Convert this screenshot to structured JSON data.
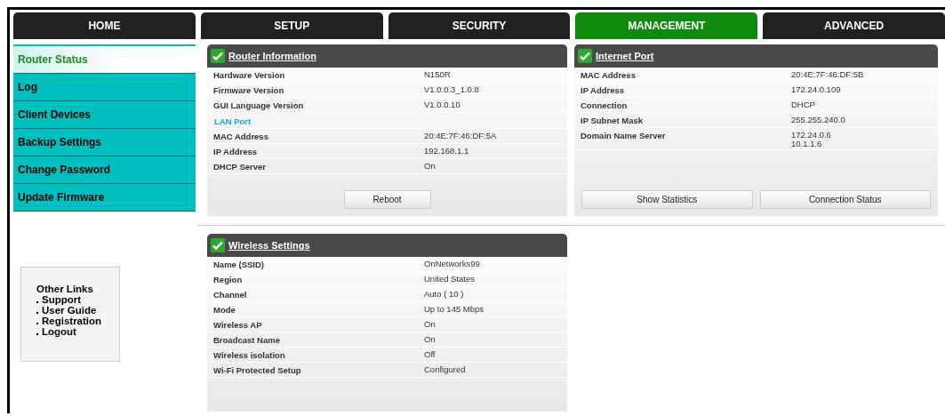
{
  "tabs": [
    {
      "label": "HOME",
      "selected": false
    },
    {
      "label": "SETUP",
      "selected": false
    },
    {
      "label": "SECURITY",
      "selected": false
    },
    {
      "label": "MANAGEMENT",
      "selected": true
    },
    {
      "label": "ADVANCED",
      "selected": false
    }
  ],
  "sidebar": {
    "items": [
      {
        "label": "Router Status",
        "selected": true
      },
      {
        "label": "Log",
        "selected": false
      },
      {
        "label": "Client Devices",
        "selected": false
      },
      {
        "label": "Backup Settings",
        "selected": false
      },
      {
        "label": "Change Password",
        "selected": false
      },
      {
        "label": "Update Firmware",
        "selected": false
      }
    ]
  },
  "other_links": {
    "title": "Other Links",
    "links": [
      "Support",
      "User Guide",
      "Registration",
      "Logout"
    ]
  },
  "panels": [
    {
      "title": "Router Information",
      "rows": [
        {
          "kind": "row",
          "label": "Hardware Version",
          "value": "N150R"
        },
        {
          "kind": "row",
          "label": "Firmware Version",
          "value": "V1.0.0.3_1.0.8"
        },
        {
          "kind": "row",
          "label": "GUI Language Version",
          "value": "V1.0.0.10"
        },
        {
          "kind": "section",
          "label": "LAN Port"
        },
        {
          "kind": "row",
          "label": "MAC Address",
          "value": "20:4E:7F:46:DF:5A"
        },
        {
          "kind": "row",
          "label": "IP Address",
          "value": "192.168.1.1"
        },
        {
          "kind": "row",
          "label": "DHCP Server",
          "value": "On"
        }
      ],
      "buttons": [
        "Reboot"
      ]
    },
    {
      "title": "Internet Port",
      "rows": [
        {
          "kind": "row",
          "label": "MAC Address",
          "value": "20:4E:7F:46:DF:5B"
        },
        {
          "kind": "row",
          "label": "IP Address",
          "value": "172.24.0.109"
        },
        {
          "kind": "row",
          "label": "Connection",
          "value": "DHCP"
        },
        {
          "kind": "row",
          "label": "IP Subnet Mask",
          "value": "255.255.240.0"
        },
        {
          "kind": "row",
          "label": "Domain Name Server",
          "value": "172.24.0.6\n10.1.1.6"
        }
      ],
      "buttons": [
        "Show Statistics",
        "Connection Status"
      ]
    },
    {
      "title": "Wireless Settings",
      "rows": [
        {
          "kind": "row",
          "label": "Name (SSID)",
          "value": "OnNetworks99"
        },
        {
          "kind": "row",
          "label": "Region",
          "value": "United States"
        },
        {
          "kind": "row",
          "label": "Channel",
          "value": "Auto ( 10 )"
        },
        {
          "kind": "row",
          "label": "Mode",
          "value": "Up to 145 Mbps"
        },
        {
          "kind": "row",
          "label": "Wireless AP",
          "value": "On"
        },
        {
          "kind": "row",
          "label": "Broadcast Name",
          "value": "On"
        },
        {
          "kind": "row",
          "label": "Wireless isolation",
          "value": "Off"
        },
        {
          "kind": "row",
          "label": "Wi-Fi Protected Setup",
          "value": "Configured"
        }
      ]
    }
  ]
}
